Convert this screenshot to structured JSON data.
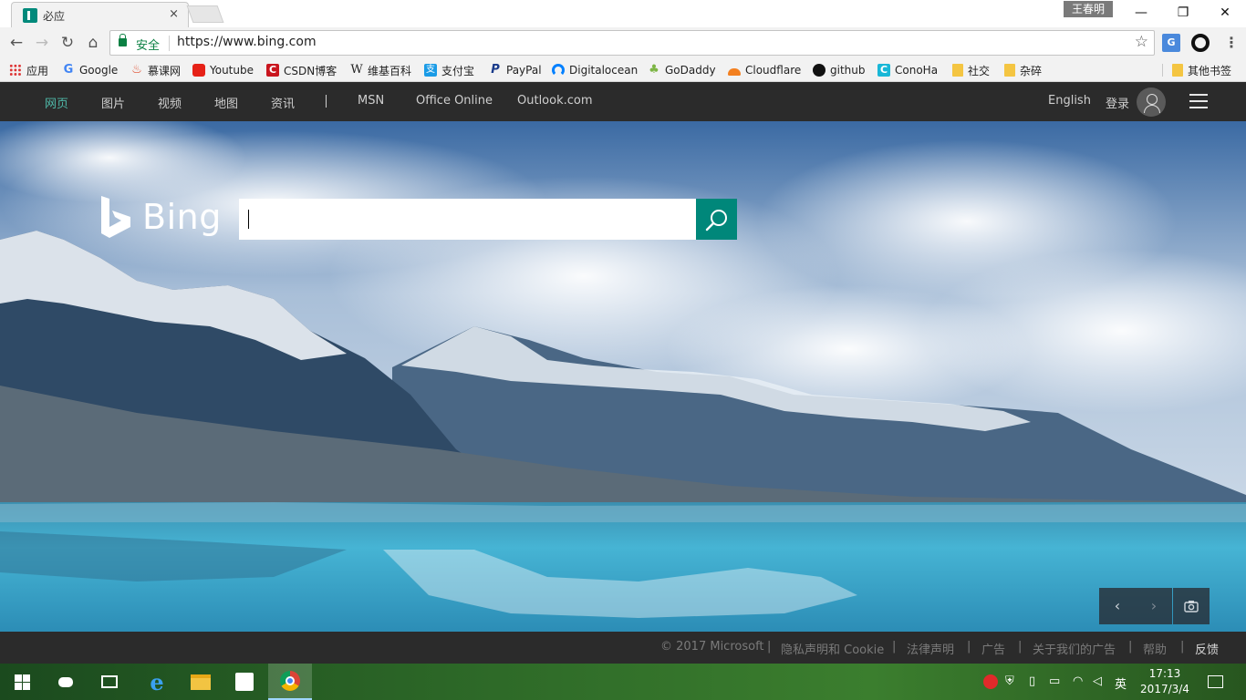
{
  "tab": {
    "title": "必应",
    "close": "×"
  },
  "titlebar": {
    "user": "王春明",
    "minimize": "—",
    "restore": "❐",
    "close": "✕"
  },
  "toolbar": {
    "back": "←",
    "forward": "→",
    "reload": "↻",
    "home": "⌂",
    "secure_label": "安全",
    "url": "https://www.bing.com",
    "star": "☆",
    "translate_ext": "G",
    "menu": "⋮"
  },
  "bookmarks": [
    {
      "label": "应用",
      "icon": "apps-grid-icon",
      "color": "#d33"
    },
    {
      "label": "Google",
      "icon": "google-icon",
      "color": "#4285f4"
    },
    {
      "label": "慕课网",
      "icon": "imooc-flame-icon",
      "color": "#e04a2a"
    },
    {
      "label": "Youtube",
      "icon": "youtube-icon",
      "color": "#e62117"
    },
    {
      "label": "CSDN博客",
      "icon": "csdn-icon",
      "color": "#c9151e"
    },
    {
      "label": "维基百科",
      "icon": "wikipedia-icon",
      "color": "#333333"
    },
    {
      "label": "支付宝",
      "icon": "alipay-icon",
      "color": "#1a9be6"
    },
    {
      "label": "PayPal",
      "icon": "paypal-icon",
      "color": "#1a3b8b"
    },
    {
      "label": "Digitalocean",
      "icon": "digitalocean-icon",
      "color": "#0080ff"
    },
    {
      "label": "GoDaddy",
      "icon": "godaddy-icon",
      "color": "#7db545"
    },
    {
      "label": "Cloudflare",
      "icon": "cloudflare-icon",
      "color": "#f38020"
    },
    {
      "label": "github",
      "icon": "github-icon",
      "color": "#111111"
    },
    {
      "label": "ConoHa",
      "icon": "conoha-icon",
      "color": "#19b7d7"
    },
    {
      "label": "社交",
      "icon": "folder-icon",
      "color": "#f4c542"
    },
    {
      "label": "杂碎",
      "icon": "folder-icon",
      "color": "#f4c542"
    }
  ],
  "other_bookmarks": "其他书签",
  "bing_nav": {
    "links": [
      "网页",
      "图片",
      "视频",
      "地图",
      "资讯"
    ],
    "divider": "|",
    "external": [
      "MSN",
      "Office Online",
      "Outlook.com"
    ],
    "language": "English",
    "login": "登录"
  },
  "search": {
    "logo_text": "Bing",
    "value": ""
  },
  "image_controls": {
    "prev": "‹",
    "next": "›"
  },
  "footer": {
    "copyright": "© 2017 Microsoft",
    "links": [
      "隐私声明和 Cookie",
      "法律声明",
      "广告",
      "关于我们的广告",
      "帮助"
    ],
    "feedback": "反馈",
    "separator": "|"
  },
  "taskbar": {
    "clock_time": "17:13",
    "clock_date": "2017/3/4",
    "ime": "英"
  },
  "colors": {
    "accent": "#00877a",
    "nav_bg": "#2b2b2b",
    "active_link": "#4fb8a8"
  }
}
